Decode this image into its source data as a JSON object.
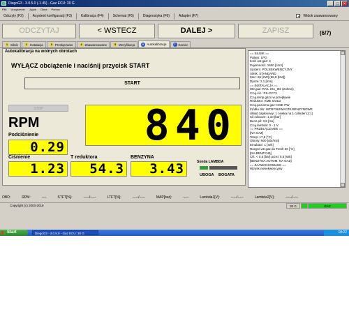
{
  "window": {
    "title": "DiegoG3 - 3.0.5.0 (-1.45) - Gaz ECU: 30 G",
    "buttons": [
      "_",
      "□",
      "×"
    ]
  },
  "menu": [
    "Plik",
    "Urządzenie",
    "Język",
    "Okna",
    "Pomoc"
  ],
  "toolbar": {
    "items": [
      "Odczyty (F2)",
      "Asystent konfiguracji (F3)",
      "Kalibracja (F4)",
      "Schemat (F5)",
      "Diagnostyka (F6)",
      "Adapter (F7)"
    ],
    "advanced_label": "Widok zaawansowany",
    "advanced_check": "✓"
  },
  "nav": {
    "read": "ODCZYTAJ",
    "back": "< WSTECZ",
    "next": "DALEJ >",
    "save": "ZAPISZ",
    "step": "(6/7)"
  },
  "tabs": [
    {
      "num": "1",
      "label": "Silnik"
    },
    {
      "num": "2",
      "label": "Instalacja"
    },
    {
      "num": "3",
      "label": "Przełączanie"
    },
    {
      "num": "4",
      "label": "Zaawansowane"
    },
    {
      "num": "5",
      "label": "Weryfikacja"
    },
    {
      "num": "6",
      "label": "Autokalibracja"
    },
    {
      "num": "7",
      "label": "Koniec"
    }
  ],
  "main": {
    "subtitle": "Autokalibracja na wolnych obrotach",
    "instruction": "WYŁĄCZ obciążenie i naciśnij przycisk START",
    "start": "START",
    "stop": "STOP",
    "rpm_label": "RPM",
    "rpm_value": "840",
    "underpressure_label": "Podciśnienie",
    "underpressure_value": "0.29",
    "pressure_label": "Ciśnienie",
    "pressure_value": "1.23",
    "reducer_label": "T reduktora",
    "reducer_value": "54.3",
    "petrol_label": "BENZYNA",
    "petrol_value": "3.43",
    "lambda_label": "Sonda LAMBDA",
    "lean": "UBOGA",
    "rich": "BOGATA"
  },
  "log": [
    "== SILNIK ==",
    "Paliwo: LPG",
    "Ilość wtr.gaz: 4",
    "Pojemność: 1600 [cm3]",
    "System: POLSEKWENCYJNY",
    "Silnik: STANDARD",
    "Moc: 65 [KW] (88,8 [KM])",
    "Dysze: 2,1 [mm]",
    "== INSTALACJA ==",
    "Wtr.gaz: RAIL IG1_t02 (2ohms)",
    "Czuj.ciś.: PS-CCT3",
    "Czuj.temp.gazu w przepływie",
    "Reduktor: KME GOLD",
    "Czuj.poziomu gaz: KME PW",
    "Źródło obr: WTRYSKIWACZE BENZYNOWE",
    "Układ zapłonowy: 1 cewka na 1 cylinder (1:1)",
    "Cił.robocze: 1,10 [bar]",
    "Benz.pil: 3,8 [ms]",
    "Czuj.lambda: 0 - 1 V",
    "== PRZEŁĄCZANIE ==",
    "[NA GAZ]",
    "Temp: 17,8 [°C]",
    "Obroty: 600 [obr/min]",
    "Emulator: 1 [sek]",
    "Rozgrz.wtr.gaz do Tresh 20 [°C]",
    "[NA BENZYNĘ]",
    "Ciś. < 0,5 [bar] przez 0,5 [sek]",
    "[BENZYNA AUTOM. NA GAZ]",
    "== ZAAWANSOWANE ==",
    "Wtrysk niesekwencyjny"
  ],
  "obd": [
    "OBD:",
    "RPM:",
    "----",
    "STFT[%]:",
    "-----/-----",
    "LTFT[%]:",
    "-----/-----",
    "MAP[bar]:",
    "-----",
    "Lambda1[V]:",
    "-----/-----",
    "Lambda2[V]:",
    "-----/-----"
  ],
  "status": {
    "copyright": "Copyright (c) 2003-2018",
    "ecu": "30 G",
    "mode": "GAZ"
  },
  "taskbar": {
    "start": "Start",
    "item": "DiegoG3 - 3.0.5.0 - Gaz ECU: 30 G",
    "clock": "18:22"
  },
  "colors": {
    "display": "#ffff00",
    "lambda_indicator": "#2e9e3e",
    "status_green": "#22cc22",
    "titlebar": "#0a246a"
  }
}
